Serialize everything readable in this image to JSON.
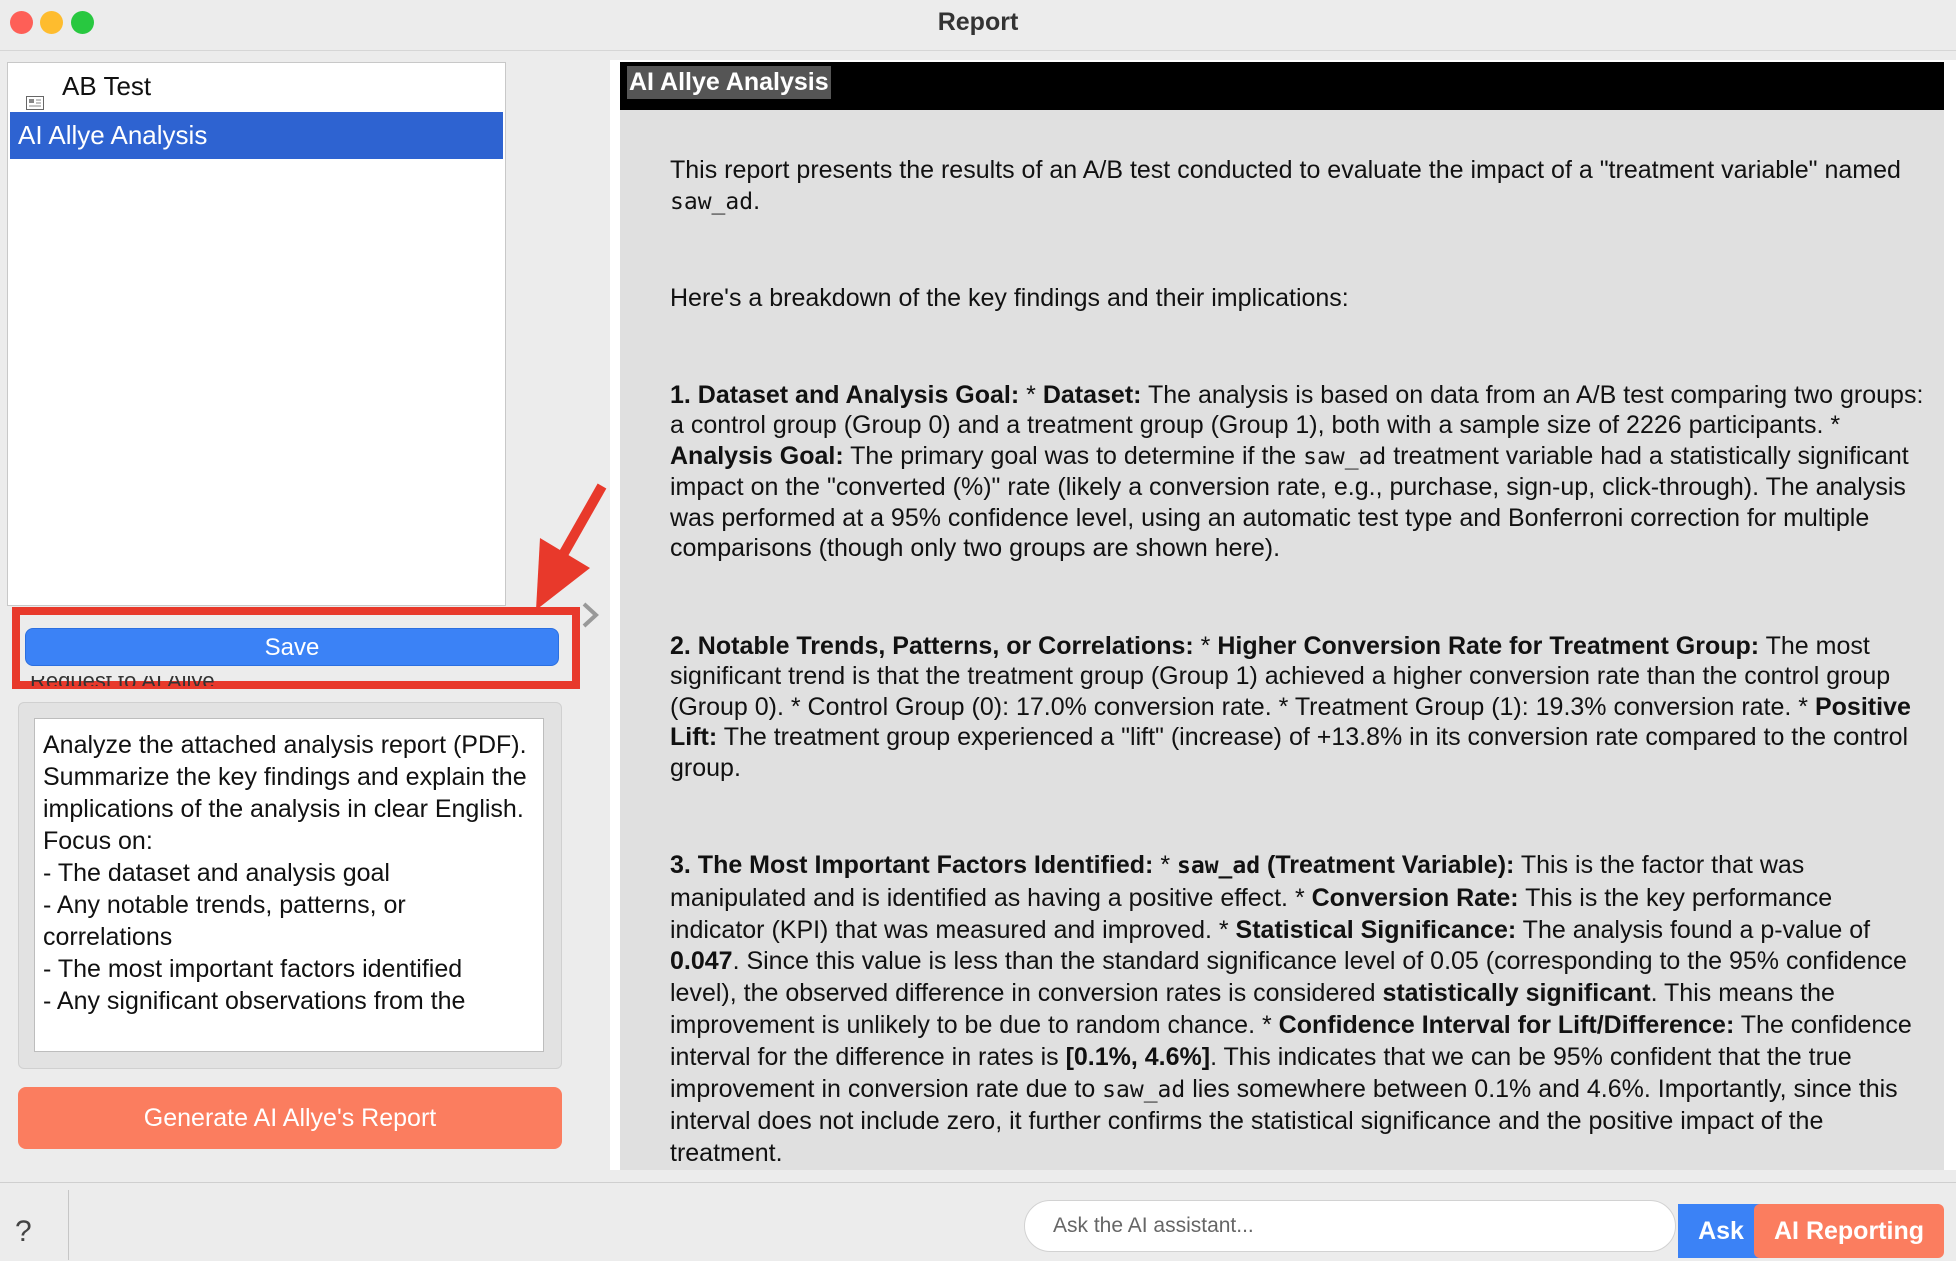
{
  "window": {
    "title": "Report"
  },
  "sidebar": {
    "items": [
      {
        "label": "AB Test",
        "icon": "report-icon",
        "selected": false
      },
      {
        "label": "AI Allye Analysis",
        "selected": true
      }
    ],
    "save_label": "Save",
    "request_label": "Request to AI Allye",
    "request_text": "Analyze the attached analysis report (PDF).\nSummarize the key findings and explain the implications of the analysis in clear English. Focus on:\n- The dataset and analysis goal\n- Any notable trends, patterns, or correlations\n- The most important factors identified\n- Any significant observations from the",
    "generate_label": "Generate AI Allye's Report"
  },
  "report": {
    "title": "AI Allye Analysis",
    "intro_1": "This report presents the results of an A/B test conducted to evaluate the impact of a \"treatment variable\" named ",
    "intro_var": "saw_ad",
    "intro_2": ".",
    "breakdown": "Here's a breakdown of the key findings and their implications:",
    "s1": {
      "h": "1. Dataset and Analysis Goal:",
      "b1": "Dataset:",
      "t1": " The analysis is based on data from an A/B test comparing two groups: a control group (Group 0) and a treatment group (Group 1), both with a sample size of 2226 participants. * ",
      "b2": "Analysis Goal:",
      "t2a": " The primary goal was to determine if the ",
      "var": "saw_ad",
      "t2b": " treatment variable had a statistically significant impact on the \"converted (%)\" rate (likely a conversion rate, e.g., purchase, sign-up, click-through). The analysis was performed at a 95% confidence level, using an automatic test type and Bonferroni correction for multiple comparisons (though only two groups are shown here)."
    },
    "s2": {
      "h": "2. Notable Trends, Patterns, or Correlations:",
      "b1": "Higher Conversion Rate for Treatment Group:",
      "t1": " The most significant trend is that the treatment group (Group 1) achieved a higher conversion rate than the control group (Group 0). * Control Group (0): 17.0% conversion rate. * Treatment Group (1): 19.3% conversion rate. * ",
      "b2": "Positive Lift:",
      "t2": " The treatment group experienced a \"lift\" (increase) of +13.8% in its conversion rate compared to the control group."
    },
    "s3": {
      "h": "3. The Most Important Factors Identified:",
      "b1_var": "saw_ad",
      "b1": " (Treatment Variable):",
      "t1": " This is the factor that was manipulated and is identified as having a positive effect. * ",
      "b2": "Conversion Rate:",
      "t2": " This is the key performance indicator (KPI) that was measured and improved. * ",
      "b3": "Statistical Significance:",
      "t3": " The analysis found a p-value of ",
      "pval": "0.047",
      "t4": ". Since this value is less than the standard significance level of 0.05 (corresponding to the 95% confidence level), the observed difference in conversion rates is considered ",
      "b4": "statistically significant",
      "t5": ". This means the improvement is unlikely to be due to random chance. * ",
      "b5": "Confidence Interval for Lift/Difference:",
      "t6": " The confidence interval for the difference in rates is ",
      "ci": "[0.1%, 4.6%]",
      "t7": ". This indicates that we can be 95% confident that the true improvement in conversion rate due to ",
      "var": "saw_ad",
      "t8": " lies somewhere between 0.1% and 4.6%. Importantly, since this interval does not include zero, it further confirms the statistical significance and the positive impact of the treatment."
    }
  },
  "bottom": {
    "help": "?",
    "ask_placeholder": "Ask the AI assistant...",
    "ask_label": "Ask",
    "ai_reporting_label": "AI Reporting"
  },
  "colors": {
    "accent": "#3b82f6",
    "orange": "#fb7d5f",
    "highlight": "#e8392b",
    "selection": "#2e63d1"
  }
}
